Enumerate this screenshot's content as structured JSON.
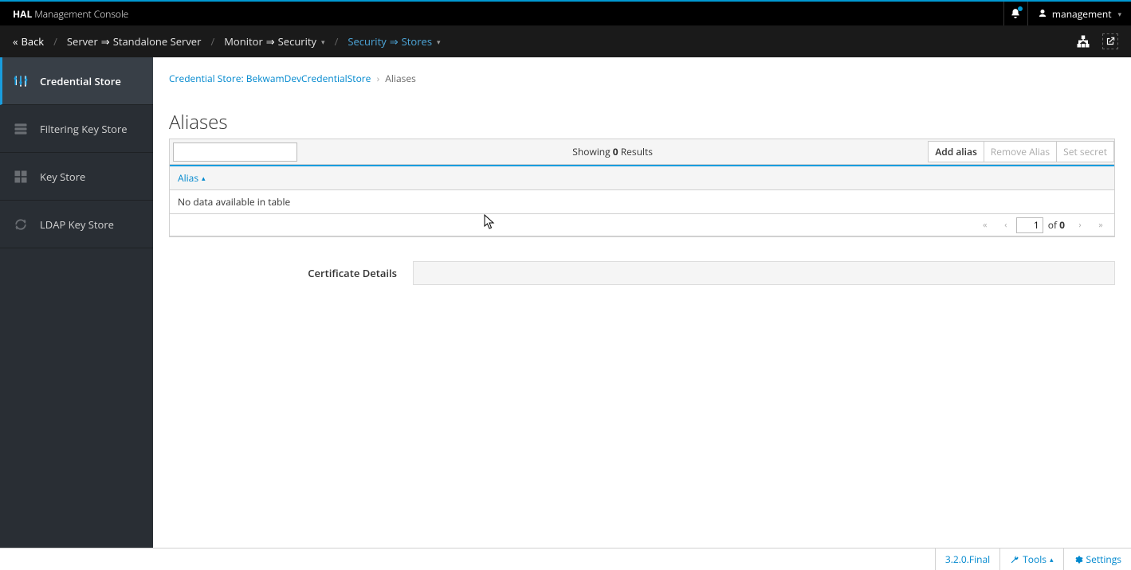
{
  "header": {
    "title_bold": "HAL",
    "title_rest": "Management Console",
    "user": "management"
  },
  "nav": {
    "back": "Back",
    "crumbs": [
      {
        "a": "Server",
        "b": "Standalone Server",
        "link": false,
        "drop": false
      },
      {
        "a": "Monitor",
        "b": "Security",
        "link": false,
        "drop": true
      },
      {
        "a": "Security",
        "b": "Stores",
        "link": true,
        "drop": true
      }
    ]
  },
  "sidebar": {
    "items": [
      {
        "label": "Credential Store",
        "active": true
      },
      {
        "label": "Filtering Key Store",
        "active": false
      },
      {
        "label": "Key Store",
        "active": false
      },
      {
        "label": "LDAP Key Store",
        "active": false
      }
    ]
  },
  "breadcrumb": {
    "link": "Credential Store: BekwamDevCredentialStore",
    "current": "Aliases"
  },
  "page": {
    "title": "Aliases",
    "results_prefix": "Showing ",
    "results_count": "0",
    "results_suffix": " Results",
    "add_btn": "Add alias",
    "remove_btn": "Remove Alias",
    "secret_btn": "Set secret",
    "col_alias": "Alias",
    "empty_text": "No data available in table",
    "page_current": "1",
    "page_of": "of",
    "page_total": "0",
    "cert_label": "Certificate Details"
  },
  "footer": {
    "version": "3.2.0.Final",
    "tools": "Tools",
    "settings": "Settings"
  }
}
